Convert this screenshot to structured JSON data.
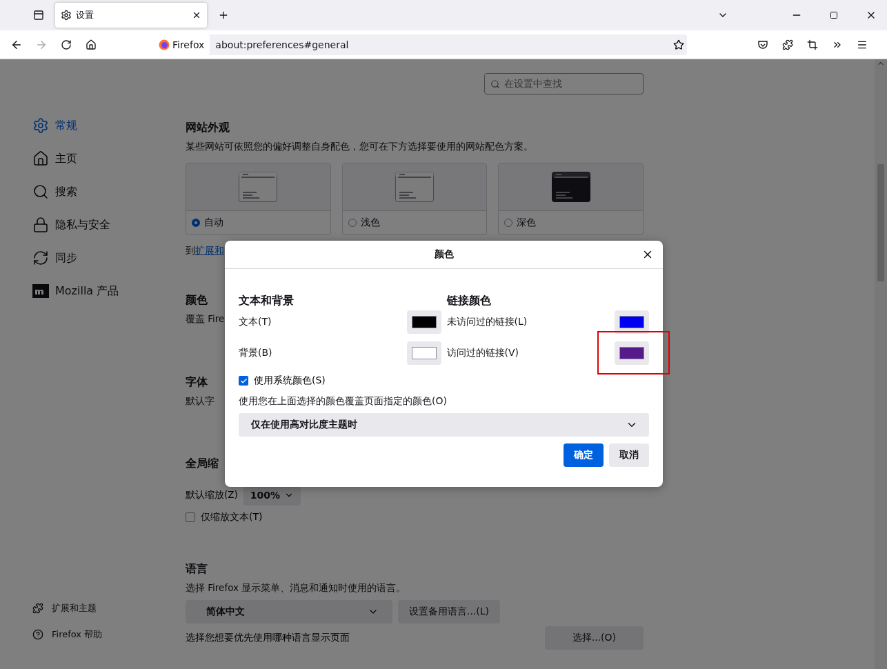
{
  "browser": {
    "tab": {
      "title": "设置",
      "selected": true
    },
    "url_badge": "Firefox",
    "url": "about:preferences#general"
  },
  "search": {
    "placeholder": "在设置中查找"
  },
  "sidebar": {
    "items": [
      {
        "label": "常规",
        "selected": true
      },
      {
        "label": "主页",
        "selected": false
      },
      {
        "label": "搜索",
        "selected": false
      },
      {
        "label": "隐私与安全",
        "selected": false
      },
      {
        "label": "同步",
        "selected": false
      },
      {
        "label": "Mozilla 产品",
        "selected": false
      }
    ],
    "footer": [
      {
        "label": "扩展和主题"
      },
      {
        "label": "Firefox 帮助"
      }
    ]
  },
  "appearance": {
    "title": "网站外观",
    "description": "某些网站可依照您的偏好调整自身配色，您可在下方选择要使用的网站配色方案。",
    "options": [
      {
        "label": "自动",
        "selected": true,
        "kind": "light"
      },
      {
        "label": "浅色",
        "selected": false,
        "kind": "light"
      },
      {
        "label": "深色",
        "selected": false,
        "kind": "dark"
      }
    ],
    "note": {
      "text": "到",
      "link": "扩展和"
    }
  },
  "colors_section": {
    "title": "颜色",
    "description": "覆盖 Fire"
  },
  "fonts": {
    "title": "字体",
    "description": "默认字"
  },
  "zoom": {
    "title": "全局缩",
    "label": "默认缩放(Z)",
    "value": "100%",
    "text_only": {
      "label": "仅缩放文本(T)",
      "checked": false
    }
  },
  "language": {
    "title": "语言",
    "description": "选择 Firefox 显示菜单、消息和通知时使用的语言。",
    "select": "简体中文",
    "alt_button": "设置备用语言...(L)",
    "page_label": "选择您想要优先使用哪种语言显示页面",
    "choose_button": "选择...(O)"
  },
  "dialog": {
    "title": "颜色",
    "groups": [
      {
        "title": "文本和背景",
        "items": [
          {
            "label": "文本(T)",
            "color": "#000000",
            "highlighted": false
          },
          {
            "label": "背景(B)",
            "color": "#ffffff",
            "highlighted": false
          }
        ]
      },
      {
        "title": "链接颜色",
        "items": [
          {
            "label": "未访问过的链接(L)",
            "color": "#0000ee",
            "highlighted": false
          },
          {
            "label": "访问过的链接(V)",
            "color": "#551a8b",
            "highlighted": true
          }
        ]
      }
    ],
    "system_colors": {
      "label": "使用系统颜色(S)",
      "checked": true
    },
    "override_label": "使用您在上面选择的颜色覆盖页面指定的颜色(O)",
    "override_select": "仅在使用高对比度主题时",
    "buttons": [
      {
        "label": "确定",
        "kind": "primary"
      },
      {
        "label": "取消",
        "kind": "secondary"
      }
    ]
  }
}
